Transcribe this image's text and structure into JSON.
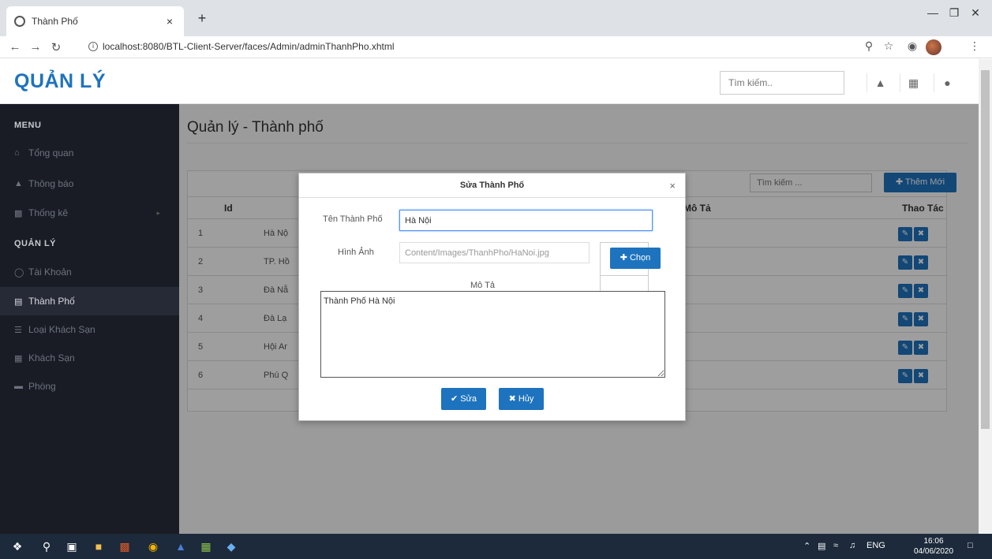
{
  "browser": {
    "tab_title": "Thành Phố",
    "tab_close": "×",
    "new_tab": "+",
    "url": "localhost:8080/BTL-Client-Server/faces/Admin/adminThanhPho.xhtml"
  },
  "header": {
    "brand": "QUẢN LÝ",
    "search_placeholder": "Tìm kiếm.."
  },
  "sidebar": {
    "menu_label": "MENU",
    "manage_label": "QUẢN LÝ",
    "items": [
      {
        "label": "Tổng quan",
        "icon": "home-icon"
      },
      {
        "label": "Thông báo",
        "icon": "bell-icon"
      },
      {
        "label": "Thống kê",
        "icon": "chart-icon"
      },
      {
        "label": "Tài Khoản",
        "icon": "user-icon"
      },
      {
        "label": "Thành Phố",
        "icon": "building-icon"
      },
      {
        "label": "Loại Khách Sạn",
        "icon": "list-icon"
      },
      {
        "label": "Khách Sạn",
        "icon": "hotel-icon"
      },
      {
        "label": "Phòng",
        "icon": "bed-icon"
      }
    ]
  },
  "main": {
    "page_title": "Quản lý - Thành phố",
    "table_search_placeholder": "Tìm kiếm ...",
    "add_button": "Thêm Mới",
    "columns": {
      "id": "Id",
      "mota": "Mô Tả",
      "thaotac": "Thao Tác"
    },
    "rows": [
      {
        "id": "1",
        "name": "Hà Nộ"
      },
      {
        "id": "2",
        "name": "TP. Hồ"
      },
      {
        "id": "3",
        "name": "Đà Nẵ"
      },
      {
        "id": "4",
        "name": "Đà Lạ"
      },
      {
        "id": "5",
        "name": "Hội Ar"
      },
      {
        "id": "6",
        "name": "Phú Q"
      }
    ]
  },
  "dialog": {
    "title": "Sửa Thành Phố",
    "close": "×",
    "name_label": "Tên Thành Phố",
    "name_value": "Hà Nội",
    "image_label": "Hình Ảnh",
    "image_value": "Content/Images/ThanhPho/HaNoi.jpg",
    "choose_button": "Chọn",
    "desc_label": "Mô Tả",
    "desc_value": "Thành Phố Hà Nội",
    "save_button": "Sửa",
    "cancel_button": "Hủy"
  },
  "taskbar": {
    "language": "ENG",
    "time": "16:06",
    "date": "04/06/2020"
  },
  "colors": {
    "accent": "#1e73be",
    "sidebar_bg": "#191c24",
    "taskbar_bg": "#1c2a3b"
  }
}
